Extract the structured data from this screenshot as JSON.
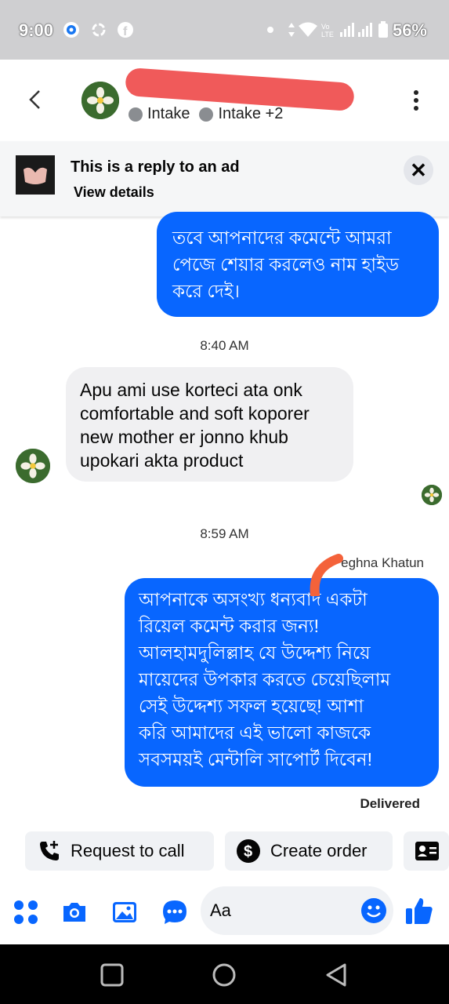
{
  "status_bar": {
    "time": "9:00",
    "battery": "56%",
    "icons": [
      "disc-icon",
      "sync-icon",
      "facebook-icon",
      "dot-icon",
      "data-arrows-icon",
      "wifi-icon",
      "volte-icon",
      "signal-icon",
      "battery-icon"
    ]
  },
  "header": {
    "labels": [
      "Intake",
      "Intake +2"
    ],
    "back_icon": "chevron-left-icon",
    "menu_icon": "kebab-icon"
  },
  "ad_reply": {
    "title": "This is a reply to an ad",
    "subtitle": "View details",
    "close_icon": "close-icon"
  },
  "messages": [
    {
      "type": "outgoing",
      "lines": [
        "তবে আপনাদের কমেন্টে আমরা",
        "পেজে শেয়ার করলেও নাম হাইড",
        "করে দেই।"
      ]
    },
    {
      "type": "timestamp",
      "text": "8:40 AM"
    },
    {
      "type": "incoming",
      "lines": [
        "Apu ami use korteci ata onk",
        "comfortable and soft koporer",
        "new mother er jonno khub",
        "upokari akta product"
      ]
    },
    {
      "type": "timestamp",
      "text": "8:59 AM"
    },
    {
      "type": "outgoing",
      "lines": [
        "আপনাকে অসংখ্য ধন্যবাদ একটা",
        "রিয়েল কমেন্ট করার জন্য!",
        "আলহামদুলিল্লাহ যে উদ্দেশ্য নিয়ে",
        "মায়েদের উপকার করতে চেয়েছিলাম",
        "সেই উদ্দেশ্য সফল হয়েছে! আশা",
        "করি আমাদের এই ভালো কাজকে",
        "সবসময়ই মেন্টালি সাপোর্ট দিবেন!"
      ]
    }
  ],
  "seen_by": "eghna Khatun",
  "delivered": "Delivered",
  "quick_actions": [
    {
      "label": "Request to call",
      "icon": "phone-plus-icon"
    },
    {
      "label": "Create order",
      "icon": "dollar-icon"
    },
    {
      "label": "",
      "icon": "contact-card-icon"
    }
  ],
  "composer": {
    "placeholder": "Aa",
    "icons": [
      "apps-icon",
      "camera-icon",
      "gallery-icon",
      "messenger-icon",
      "emoji-icon",
      "thumbs-up-icon"
    ]
  },
  "nav": [
    "recents-icon",
    "home-icon",
    "back-icon"
  ],
  "colors": {
    "accent": "#0866ff",
    "bubble_in": "#f0f0f2",
    "redaction": "#f05a5a"
  }
}
